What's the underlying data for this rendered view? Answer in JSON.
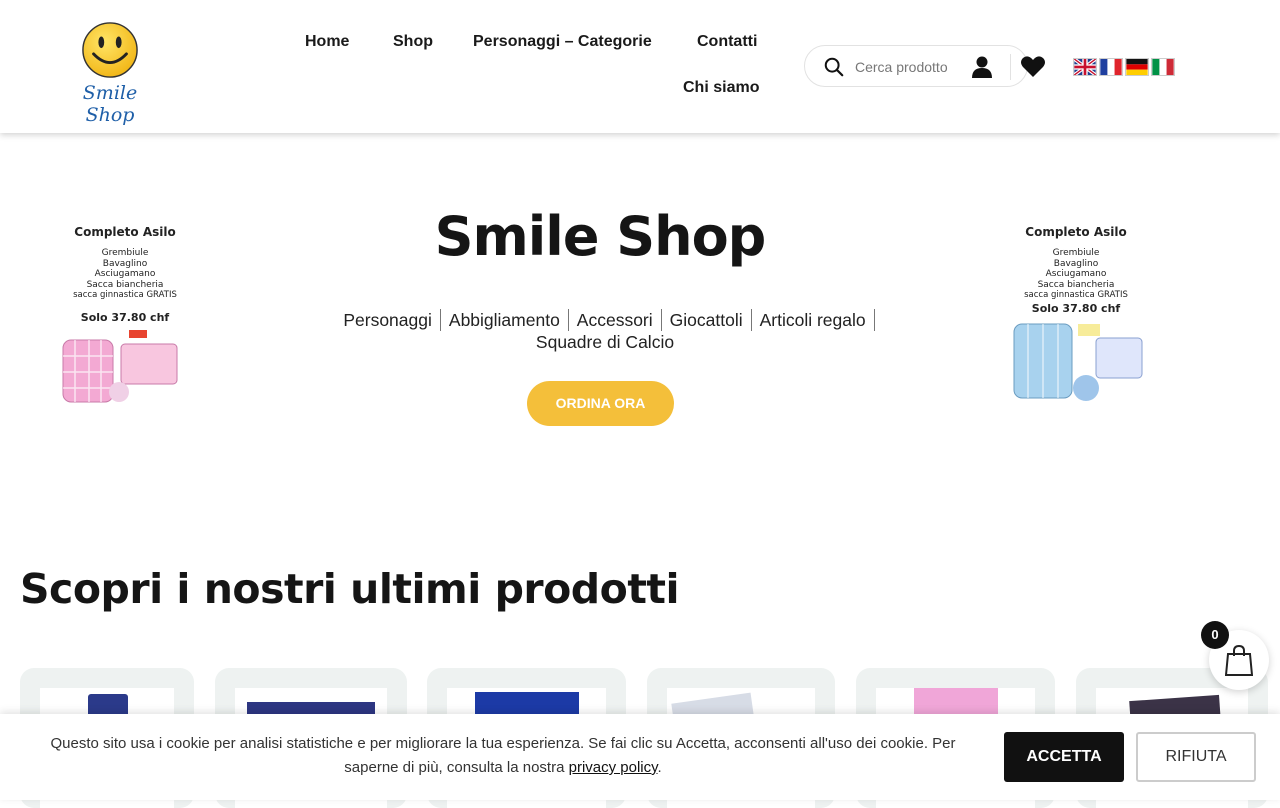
{
  "brand": {
    "logo_text": "Smile Shop"
  },
  "nav": {
    "items": [
      {
        "label": "Home"
      },
      {
        "label": "Shop"
      },
      {
        "label": "Personaggi – Categorie"
      },
      {
        "label": "Contatti"
      },
      {
        "label": "Chi siamo"
      }
    ]
  },
  "search": {
    "placeholder": "Cerca prodotto"
  },
  "languages": [
    "English",
    "Français",
    "Deutsch",
    "Italiano"
  ],
  "hero": {
    "title": "Smile Shop",
    "categories": [
      "Personaggi",
      "Abbigliamento",
      "Accessori",
      "Giocattoli",
      "Articoli regalo",
      "Squadre di Calcio"
    ],
    "cta": "ORDINA ORA"
  },
  "promo": {
    "title": "Completo Asilo",
    "items": [
      "Grembiule",
      "Bavaglino",
      "Asciugamano",
      "Sacca biancheria",
      "sacca ginnastica GRATIS"
    ],
    "price": "Solo 37.80 chf"
  },
  "products_section": {
    "title": "Scopri i nostri ultimi prodotti"
  },
  "cart": {
    "count": "0"
  },
  "cookie": {
    "text_before": "Questo sito usa i cookie per analisi statistiche e per migliorare la tua esperienza. Se fai clic su Accetta, acconsenti all'uso dei cookie. Per saperne di più, consulta la nostra ",
    "link": "privacy policy",
    "text_after": ".",
    "accept": "ACCETTA",
    "reject": "RIFIUTA"
  },
  "colors": {
    "accent": "#f4bf3a",
    "dark": "#111111",
    "card_bg": "#eef2f1",
    "logo_blue": "#1f5fa8"
  }
}
